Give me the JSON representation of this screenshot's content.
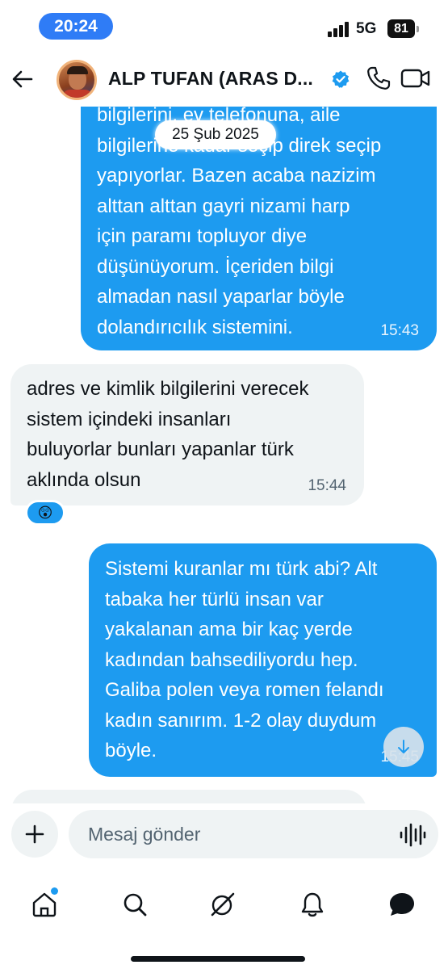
{
  "status_bar": {
    "time": "20:24",
    "network": "5G",
    "battery": "81"
  },
  "header": {
    "contact_name": "ALP TUFAN (ARAS D...",
    "verified": true
  },
  "date_separator": "25 Şub 2025",
  "messages": [
    {
      "direction": "outgoing",
      "lines": [
        "bilgilerini, ev telefonuna, aile",
        "bilgilerine kadar seçip direk seçip",
        "yapıyorlar. Bazen acaba nazizim",
        "alttan alttan gayri nizami harp",
        "için paramı topluyor diye",
        "düşünüyorum. İçeriden bilgi",
        "almadan nasıl yaparlar böyle",
        "dolandırıcılık sistemini."
      ],
      "time": "15:43"
    },
    {
      "direction": "incoming",
      "lines": [
        "adres ve kimlik bilgilerini verecek",
        "sistem içindeki insanları",
        "buluyorlar bunları yapanlar türk",
        "aklında olsun"
      ],
      "time": "15:44",
      "reaction": "😲"
    },
    {
      "direction": "outgoing",
      "lines": [
        "Sistemi kuranlar mı türk abi? Alt",
        "tabaka her türlü insan var",
        "yakalanan ama bir kaç yerde",
        "kadından bahsediliyordu hep.",
        "Galiba polen veya romen felandı",
        "kadın sanırım. 1-2 olay duydum",
        "böyle."
      ],
      "time": "15:45"
    },
    {
      "direction": "incoming",
      "lines": [],
      "time": ""
    }
  ],
  "composer": {
    "placeholder": "Mesaj gönder"
  },
  "nav": {
    "items": [
      "home",
      "search",
      "grok",
      "notifications",
      "messages"
    ],
    "active": "messages"
  },
  "colors": {
    "outgoing_bubble": "#1d9bf0",
    "incoming_bubble": "#eff3f4",
    "time_pill": "#2f7cf6"
  }
}
